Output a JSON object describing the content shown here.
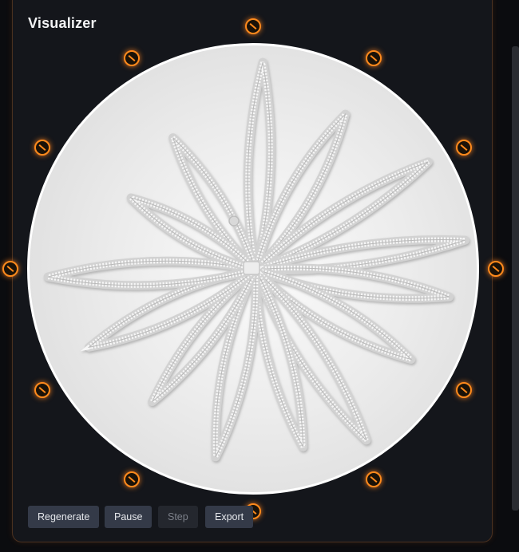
{
  "panel": {
    "title": "Visualizer"
  },
  "controls": {
    "regenerate_label": "Regenerate",
    "pause_label": "Pause",
    "step_label": "Step",
    "export_label": "Export"
  },
  "step_enabled": false,
  "colors": {
    "accent": "#ff8a1c",
    "panel_bg": "#14161b",
    "button_bg": "#343a48",
    "disc_bg": "#e6e6e6",
    "disc_border": "#ffffff"
  },
  "pin_icon": "orange-circle-pin-icon",
  "pin_count": 12
}
